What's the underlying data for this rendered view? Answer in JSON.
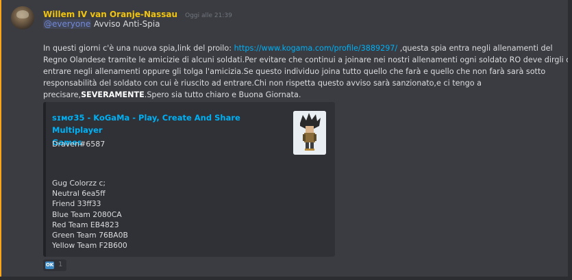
{
  "message": {
    "author": "Willem IV van Oranje-Nassau",
    "timestamp": "Oggi alle 21:39",
    "mention": "@everyone",
    "mention_suffix": " Avviso Anti-Spia",
    "line1_a": "In questi giorni c'è una nuova spia,link del proilo: ",
    "link_url": "https://www.kogama.com/profile/3889297/",
    "line1_b": " ,questa spia entra negli allenamenti del",
    "line2": "Regno Olandese tramite le amicizie di alcuni soldati.Per evitare che continui a joinare nei nostri allenamenti ogni soldato RO deve dirgli di non",
    "line3": "entrare negli allenamenti oppure gli tolga l'amicizia.Se questo individuo joina tutto quello che farà e quello che non farà sarà sotto",
    "line4": "responsabilità del soldato con cui è riuscito ad entrare.Chi non rispetta questo avviso sarà sanzionato,e ci tengo a",
    "line5_a": "precisare,",
    "line5_bold": "SEVERAMENTE",
    "line5_b": ".Spero sia tutto chiaro e Buona Giornata."
  },
  "embed": {
    "title_line1": "ꜱɪᴍσ35  -  KoGaMa - Play, Create And Share Multiplayer",
    "title_line2": "Games",
    "author": "Draven#6587",
    "description": [
      "Gug Colorzz c;",
      "Neutral 6ea5ff",
      "Friend 33ff33",
      "Blue Team 2080CA",
      "Red Team EB4823",
      "Green Team 76BA0B",
      "Yellow Team F2B600"
    ]
  },
  "reaction": {
    "emoji": "OK",
    "count": "1"
  },
  "colors": {
    "username": "#f1c40f",
    "link": "#00b0f4",
    "mention": "#7289da",
    "mention_bar": "#faa61a"
  }
}
